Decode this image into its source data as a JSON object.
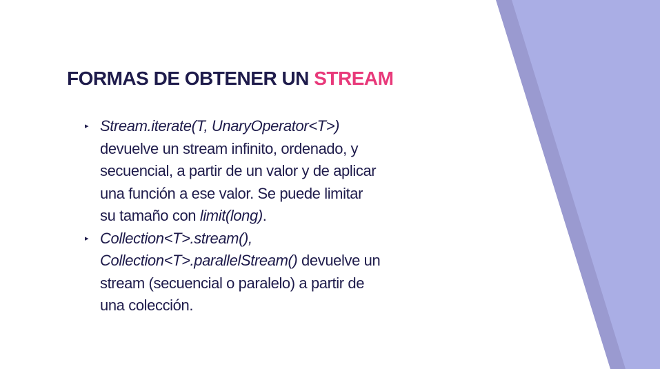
{
  "slide": {
    "title_main": "FORMAS DE OBTENER UN ",
    "title_accent": "STREAM",
    "colors": {
      "title": "#1e1b4b",
      "accent": "#e8397a",
      "band_dark": "#9a9ad0",
      "band_light": "#aaaee5"
    },
    "bullet_icon": "triangle-right-bullet",
    "bullets": [
      {
        "lines": [
          [
            {
              "t": "Stream.iterate(T, UnaryOperator<T>)",
              "i": true
            }
          ],
          [
            {
              "t": "devuelve un stream infinito, ordenado, y",
              "i": false
            }
          ],
          [
            {
              "t": "secuencial, a partir de un valor y de aplicar",
              "i": false
            }
          ],
          [
            {
              "t": "una función a ese valor. Se puede limitar",
              "i": false
            }
          ],
          [
            {
              "t": "su tamaño con ",
              "i": false
            },
            {
              "t": "limit(long)",
              "i": true
            },
            {
              "t": ".",
              "i": false
            }
          ]
        ]
      },
      {
        "lines": [
          [
            {
              "t": "Collection<T>.stream(),",
              "i": true
            }
          ],
          [
            {
              "t": "Collection<T>.parallelStream()",
              "i": true
            },
            {
              "t": " devuelve un",
              "i": false
            }
          ],
          [
            {
              "t": "stream (secuencial o paralelo) a partir de",
              "i": false
            }
          ],
          [
            {
              "t": "una colección.",
              "i": false
            }
          ]
        ]
      }
    ]
  }
}
